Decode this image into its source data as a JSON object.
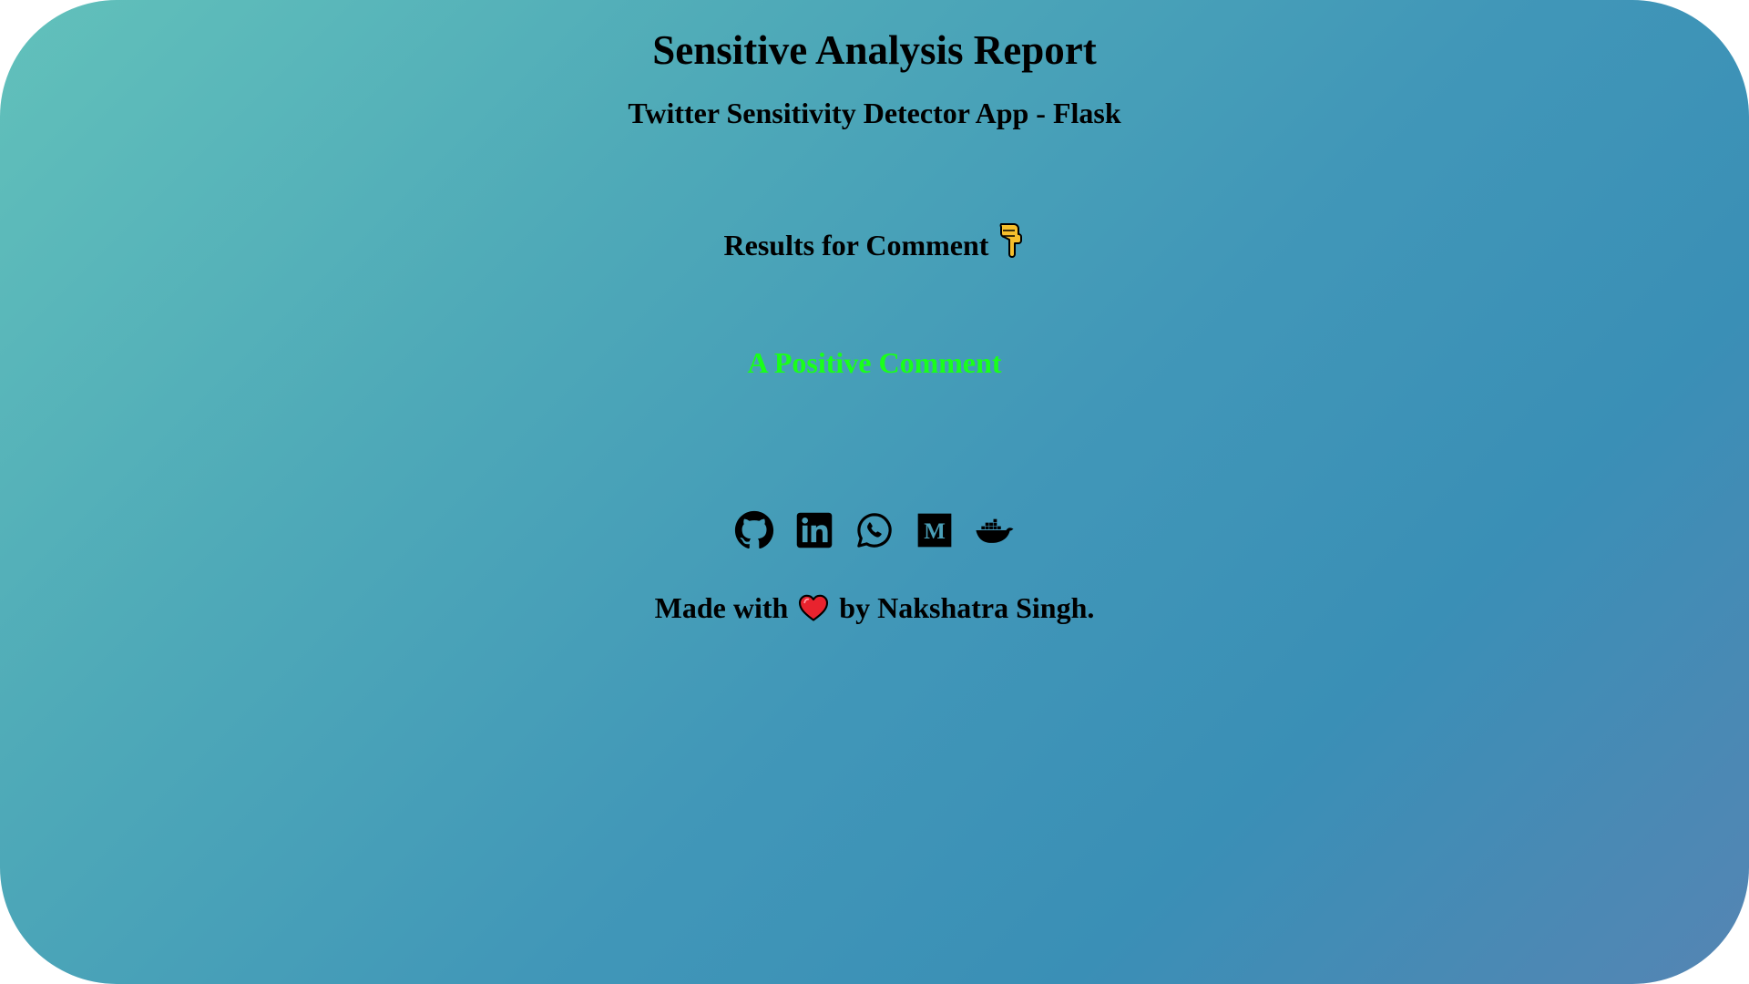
{
  "header": {
    "title": "Sensitive Analysis Report",
    "subtitle": "Twitter Sensitivity Detector App - Flask"
  },
  "results": {
    "label": "Results for Comment",
    "pointer_icon": "pointing-down-hand-icon",
    "verdict": "A Positive Comment",
    "verdict_color": "#1aff1a"
  },
  "socials": [
    {
      "name": "github-icon"
    },
    {
      "name": "linkedin-icon"
    },
    {
      "name": "whatsapp-icon"
    },
    {
      "name": "medium-icon"
    },
    {
      "name": "docker-icon"
    }
  ],
  "footer": {
    "made_with": "Made with",
    "heart_icon": "heart-icon",
    "by_line": "by Nakshatra Singh."
  },
  "colors": {
    "gradient_start": "#62c1bb",
    "gradient_mid": "#3a8fb6",
    "gradient_end": "#5585b3"
  }
}
